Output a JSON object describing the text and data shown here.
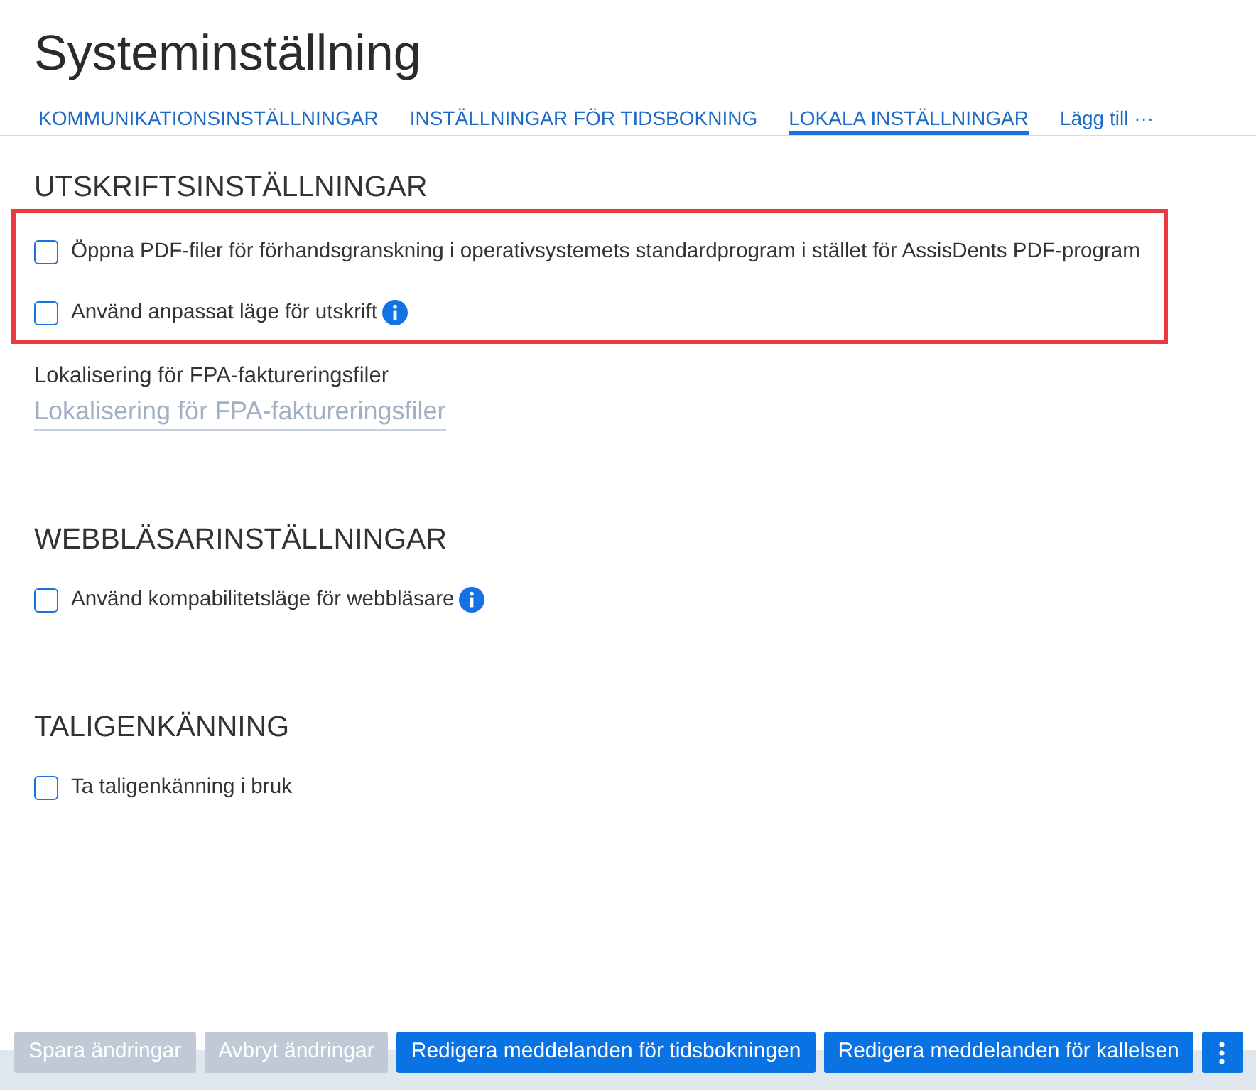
{
  "page": {
    "title": "Systeminställning"
  },
  "tabs": [
    {
      "label": "KOMMUNIKATIONSINSTÄLLNINGAR",
      "selected": false
    },
    {
      "label": "INSTÄLLNINGAR FÖR TIDSBOKNING",
      "selected": false
    },
    {
      "label": "LOKALA INSTÄLLNINGAR",
      "selected": true
    },
    {
      "label": "Lägg till ···",
      "selected": false
    }
  ],
  "sections": [
    {
      "title": "UTSKRIFTSINSTÄLLNINGAR",
      "highlighted": true,
      "options": [
        {
          "label": "Öppna PDF-filer för förhandsgranskning i operativsystemets standardprogram i stället för AssisDents PDF-program",
          "checked": false,
          "info": false
        },
        {
          "label": "Använd anpassat läge för utskrift",
          "checked": false,
          "info": true
        }
      ],
      "field": {
        "label": "Lokalisering för FPA-faktureringsfiler",
        "placeholder": "Lokalisering för FPA-faktureringsfiler"
      }
    },
    {
      "title": "WEBBLÄSARINSTÄLLNINGAR",
      "highlighted": false,
      "options": [
        {
          "label": "Använd kompabilitetsläge för webbläsare",
          "checked": false,
          "info": true
        }
      ]
    },
    {
      "title": "TALIGENKÄNNING",
      "highlighted": false,
      "options": [
        {
          "label": "Ta taligenkänning i bruk",
          "checked": false,
          "info": false
        }
      ]
    }
  ],
  "footer": {
    "buttons": [
      {
        "label": "Spara ändringar",
        "disabled": true
      },
      {
        "label": "Avbryt ändringar",
        "disabled": true
      },
      {
        "label": "Redigera meddelanden för tidsbokningen",
        "disabled": false
      },
      {
        "label": "Redigera meddelanden för kallelsen",
        "disabled": false
      }
    ],
    "more_menu": true
  }
}
